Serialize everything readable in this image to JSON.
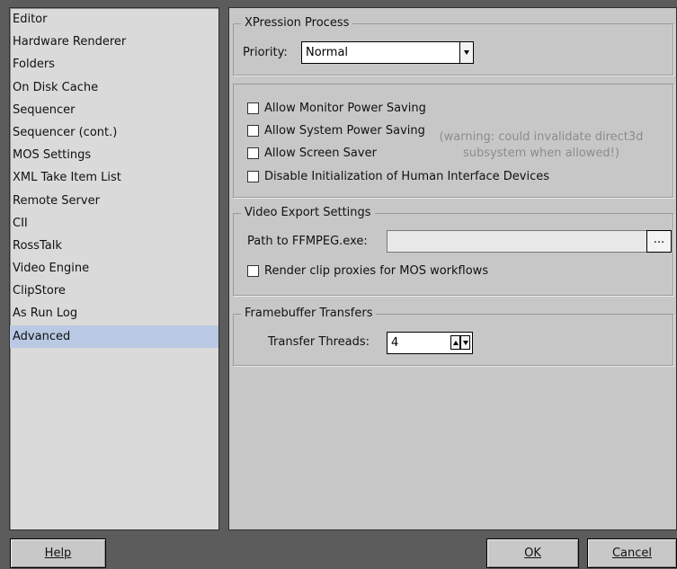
{
  "sidebar": {
    "items": [
      {
        "label": "Editor"
      },
      {
        "label": "Hardware Renderer"
      },
      {
        "label": "Folders"
      },
      {
        "label": "On Disk Cache"
      },
      {
        "label": "Sequencer"
      },
      {
        "label": "Sequencer (cont.)"
      },
      {
        "label": "MOS Settings"
      },
      {
        "label": "XML Take Item List"
      },
      {
        "label": "Remote Server"
      },
      {
        "label": "CII"
      },
      {
        "label": "RossTalk"
      },
      {
        "label": "Video Engine"
      },
      {
        "label": "ClipStore"
      },
      {
        "label": "As Run Log"
      },
      {
        "label": "Advanced"
      }
    ],
    "selected": "Advanced"
  },
  "process": {
    "title": "XPression Process",
    "priority_label": "Priority:",
    "priority_value": "Normal"
  },
  "power": {
    "monitor_label": "Allow Monitor Power Saving",
    "system_label": "Allow System Power Saving",
    "screensaver_label": "Allow Screen Saver",
    "hid_label": "Disable Initialization of Human Interface Devices",
    "warning_line1": "(warning: could invalidate direct3d",
    "warning_line2": "subsystem when allowed!)"
  },
  "video_export": {
    "title": "Video Export Settings",
    "path_label": "Path to FFMPEG.exe:",
    "path_value": "",
    "browse_label": "...",
    "proxies_label": "Render clip proxies for MOS workflows"
  },
  "framebuffer": {
    "title": "Framebuffer Transfers",
    "threads_label": "Transfer Threads:",
    "threads_value": "4"
  },
  "buttons": {
    "help_label": "Help",
    "ok_label": "OK",
    "cancel_label": "Cancel"
  }
}
